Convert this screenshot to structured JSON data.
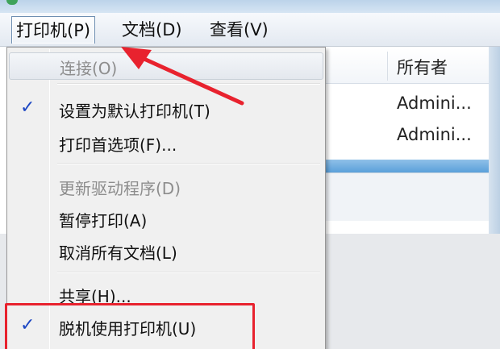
{
  "menubar": {
    "printer_label": "打印机(P)",
    "document_label": "文档(D)",
    "view_label": "查看(V)"
  },
  "list": {
    "owner_header": "所有者",
    "rows": [
      "Admini...",
      "Admini..."
    ]
  },
  "dropdown": {
    "items": [
      {
        "label": "连接(O)",
        "enabled": false,
        "checked": false
      },
      {
        "label": "设置为默认打印机(T)",
        "enabled": true,
        "checked": true
      },
      {
        "label": "打印首选项(F)...",
        "enabled": true,
        "checked": false
      },
      {
        "label": "更新驱动程序(D)",
        "enabled": false,
        "checked": false
      },
      {
        "label": "暂停打印(A)",
        "enabled": true,
        "checked": false
      },
      {
        "label": "取消所有文档(L)",
        "enabled": true,
        "checked": false
      },
      {
        "label": "共享(H)...",
        "enabled": true,
        "checked": false
      },
      {
        "label": "脱机使用打印机(U)",
        "enabled": true,
        "checked": true
      }
    ],
    "check_glyph": "✓"
  },
  "colors": {
    "annotation_red": "#e8222e",
    "check_blue": "#1d47c3",
    "menu_bg": "#f0f0f0"
  }
}
